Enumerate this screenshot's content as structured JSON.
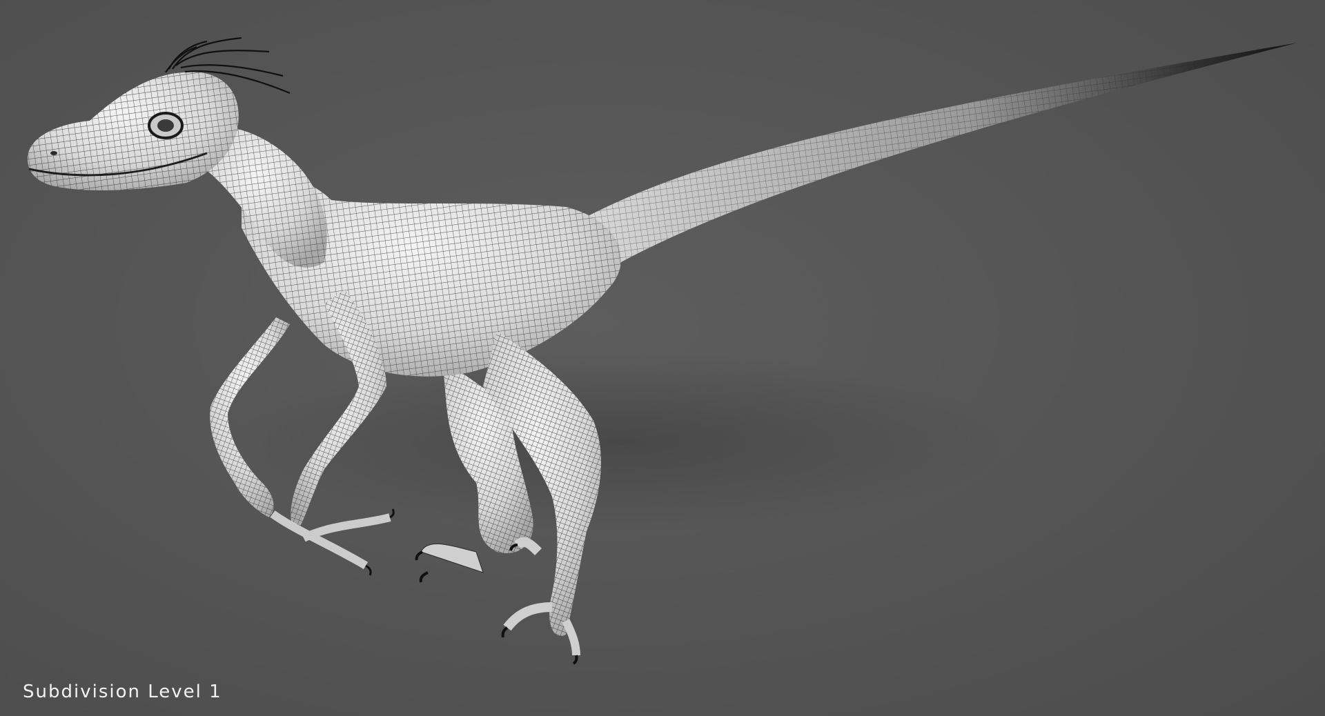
{
  "caption": "Subdivision Level 1",
  "colors": {
    "background": "#555555",
    "model_surface": "#e6e6e6",
    "wire": "#2a2a2a",
    "caption_text": "#f2f2f2"
  },
  "subject": "raptor-wireframe-render"
}
